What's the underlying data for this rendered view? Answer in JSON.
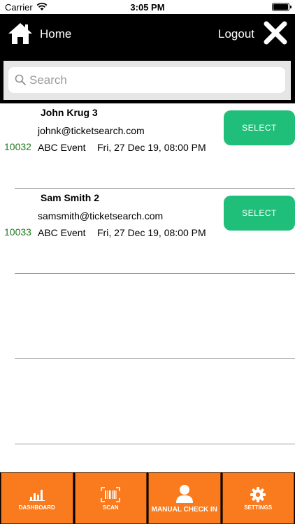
{
  "status_bar": {
    "carrier": "Carrier",
    "time": "3:05 PM"
  },
  "header": {
    "home_label": "Home",
    "logout_label": "Logout",
    "icons": {
      "home": "home-icon",
      "close": "close-icon"
    }
  },
  "search": {
    "placeholder": "Search",
    "value": ""
  },
  "attendees": [
    {
      "name": "John Krug 3",
      "email": "johnk@ticketsearch.com",
      "id": "10032",
      "event": "ABC Event",
      "date": "Fri, 27 Dec 19, 08:00 PM",
      "button_label": "SELECT"
    },
    {
      "name": "Sam Smith 2",
      "email": "samsmith@ticketsearch.com",
      "id": "10033",
      "event": "ABC Event",
      "date": "Fri, 27 Dec 19, 08:00 PM",
      "button_label": "SELECT"
    }
  ],
  "tabs": [
    {
      "label": "DASHBOARD",
      "icon": "bar-chart-icon"
    },
    {
      "label": "SCAN",
      "icon": "barcode-icon"
    },
    {
      "label": "MANUAL CHECK IN",
      "icon": "person-icon",
      "active": true
    },
    {
      "label": "SETTINGS",
      "icon": "gear-icon"
    }
  ],
  "colors": {
    "header_bg": "#000000",
    "select_button": "#1fbf7a",
    "tab_bg": "#fa7a1e",
    "id_text": "#1f7a1f"
  }
}
